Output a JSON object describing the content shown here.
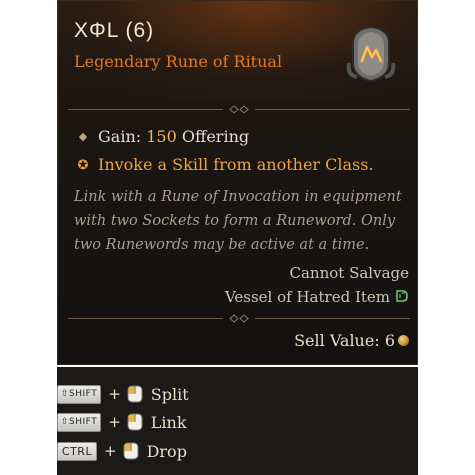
{
  "item": {
    "title": "XΦL (6)",
    "subtitle": "Legendary Rune of Ritual",
    "icon": "rune-ritual-icon",
    "gain_prefix": "Gain: ",
    "gain_value": "150",
    "gain_suffix": " Offering",
    "legendary_effect": "Invoke a Skill from another Class.",
    "flavor": "Link with a Rune of Invocation in equipment with two Sockets to form a Runeword. Only two Runewords may be active at a time.",
    "cannot_salvage": "Cannot Salvage",
    "vessel": "Vessel of Hatred Item",
    "vessel_icon": "vessel-of-hatred-icon",
    "sell_label": "Sell Value: ",
    "sell_value": "6",
    "currency_icon": "gold-coin-icon"
  },
  "hints": [
    {
      "key": "⇧SHIFT",
      "action": "Split",
      "mouse_icon": "left-click-icon"
    },
    {
      "key": "⇧SHIFT",
      "action": "Link",
      "mouse_icon": "left-click-icon"
    },
    {
      "key": "CTRL",
      "action": "Drop",
      "mouse_icon": "left-click-icon"
    }
  ],
  "colors": {
    "legendary": "#e07a22",
    "gain_value": "#f0b35a",
    "tooltip_bg": "#171412"
  }
}
